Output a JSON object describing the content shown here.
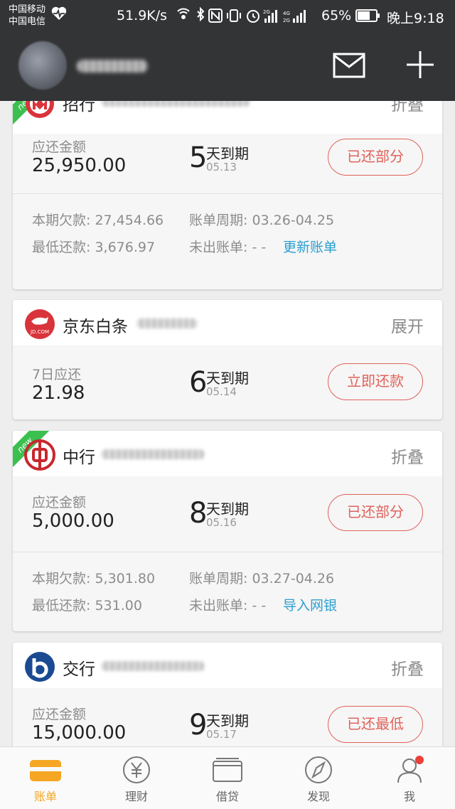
{
  "status_bar": {
    "carrier_1": "中国移动",
    "carrier_2": "中国电信",
    "net_speed": "51.9K/s",
    "battery": "65%",
    "time": "晚上9:18"
  },
  "header": {
    "icons": [
      "mail-icon",
      "plus-icon"
    ]
  },
  "cards": [
    {
      "bank": "招行",
      "toggle": "折叠",
      "new_badge": "new",
      "amount_label": "应还金额",
      "amount": "25,950.00",
      "days": "5",
      "days_text": "天到期",
      "due_date": "05.13",
      "action": "已还部分",
      "detail": {
        "balance": "本期欠款: 27,454.66",
        "cycle": "账单周期: 03.26-04.25",
        "min_pay": "最低还款: 3,676.97",
        "unbilled": "未出账单: - -",
        "link": "更新账单"
      }
    },
    {
      "bank": "京东白条",
      "toggle": "展开",
      "logo_text": "JD.COM",
      "amount_label": "7日应还",
      "amount": "21.98",
      "days": "6",
      "days_text": "天到期",
      "due_date": "05.14",
      "action": "立即还款"
    },
    {
      "bank": "中行",
      "toggle": "折叠",
      "new_badge": "new",
      "amount_label": "应还金额",
      "amount": "5,000.00",
      "days": "8",
      "days_text": "天到期",
      "due_date": "05.16",
      "action": "已还部分",
      "detail": {
        "balance": "本期欠款: 5,301.80",
        "cycle": "账单周期: 03.27-04.26",
        "min_pay": "最低还款: 531.00",
        "unbilled": "未出账单: - -",
        "link": "导入网银"
      }
    },
    {
      "bank": "交行",
      "toggle": "折叠",
      "amount_label": "应还金额",
      "amount": "15,000.00",
      "days": "9",
      "days_text": "天到期",
      "due_date": "05.17",
      "action": "已还最低"
    }
  ],
  "tabs": [
    {
      "label": "账单",
      "icon": "bill-icon",
      "active": true
    },
    {
      "label": "理财",
      "icon": "yen-coin-icon"
    },
    {
      "label": "借贷",
      "icon": "loan-card-icon"
    },
    {
      "label": "发现",
      "icon": "compass-icon"
    },
    {
      "label": "我",
      "icon": "user-icon"
    }
  ],
  "colors": {
    "header_bg": "#333436",
    "accent_red": "#e0625a",
    "link_blue": "#2b9fd0",
    "active_tab": "#f5a623",
    "new_green": "#3bbf4f"
  }
}
